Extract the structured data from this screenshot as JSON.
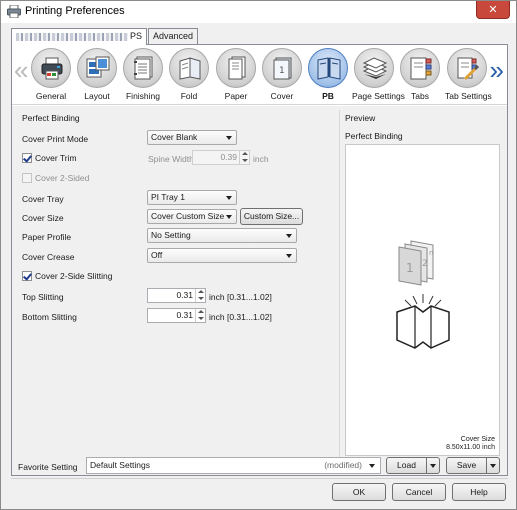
{
  "window": {
    "title": "Printing Preferences",
    "close_glyph": "✕"
  },
  "tabs": [
    {
      "label": "PS",
      "active": true
    },
    {
      "label": "Advanced",
      "active": false
    }
  ],
  "categories": [
    {
      "label": "General",
      "icon": "printer-icon"
    },
    {
      "label": "Layout",
      "icon": "layout-icon"
    },
    {
      "label": "Finishing",
      "icon": "finishing-icon"
    },
    {
      "label": "Fold",
      "icon": "fold-icon"
    },
    {
      "label": "Paper",
      "icon": "paper-icon"
    },
    {
      "label": "Cover",
      "icon": "cover-icon"
    },
    {
      "label": "PB",
      "icon": "perfect-binding-icon",
      "selected": true
    },
    {
      "label": "Page Settings",
      "icon": "page-settings-icon"
    },
    {
      "label": "Tabs",
      "icon": "tabs-icon"
    },
    {
      "label": "Tab Settings",
      "icon": "tab-settings-icon"
    }
  ],
  "nav": {
    "left": "«",
    "right": "»"
  },
  "pb": {
    "section_title": "Perfect Binding",
    "cover_print_mode": {
      "label": "Cover Print Mode",
      "value": "Cover Blank"
    },
    "cover_trim": {
      "label": "Cover Trim",
      "checked": true
    },
    "spine_width": {
      "label": "Spine Width",
      "value": "0.39",
      "unit": "inch"
    },
    "cover_2sided": {
      "label": "Cover 2-Sided",
      "checked": false
    },
    "cover_tray": {
      "label": "Cover Tray",
      "value": "PI Tray 1"
    },
    "cover_size": {
      "label": "Cover Size",
      "value": "Cover Custom Size",
      "button": "Custom Size..."
    },
    "paper_profile": {
      "label": "Paper Profile",
      "value": "No Setting"
    },
    "cover_crease": {
      "label": "Cover Crease",
      "value": "Off"
    },
    "slitting": {
      "label": "Cover 2-Side Slitting",
      "checked": true
    },
    "top_slitting": {
      "label": "Top Slitting",
      "value": "0.31",
      "unit": "inch [0.31...1.02]"
    },
    "bottom_slitting": {
      "label": "Bottom Slitting",
      "value": "0.31",
      "unit": "inch [0.31...1.02]"
    }
  },
  "preview": {
    "title": "Preview",
    "subtitle": "Perfect Binding",
    "page_numbers": [
      "1",
      "2",
      "n"
    ],
    "cover_size_label": "Cover Size",
    "cover_size_value": "8.50x11.00 inch"
  },
  "favorite": {
    "label": "Favorite Setting",
    "value": "Default Settings",
    "modified": "(modified)",
    "load": "Load",
    "save": "Save"
  },
  "buttons": {
    "ok": "OK",
    "cancel": "Cancel",
    "help": "Help"
  },
  "colors": {
    "selected_accent": "#6f9bd1",
    "close_button": "#c9483c",
    "nav_arrow": "#2b5ea8"
  }
}
